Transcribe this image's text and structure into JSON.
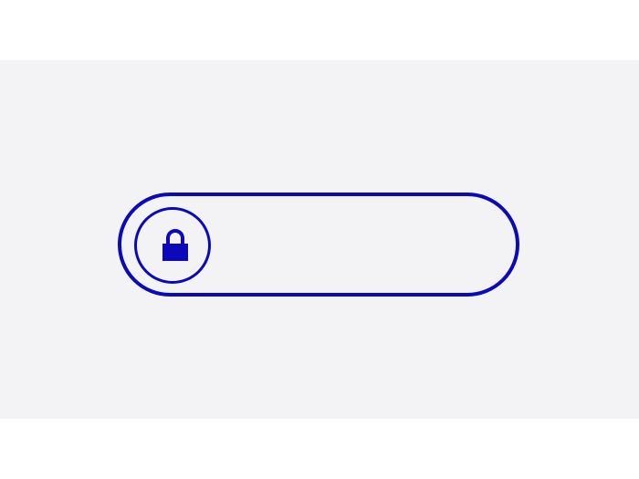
{
  "slider": {
    "type": "slide-to-unlock",
    "state": "locked",
    "progress": 0,
    "thumb_icon": "lock-icon",
    "accent_color": "#0a0aba",
    "background_color": "#f3f3f6"
  }
}
